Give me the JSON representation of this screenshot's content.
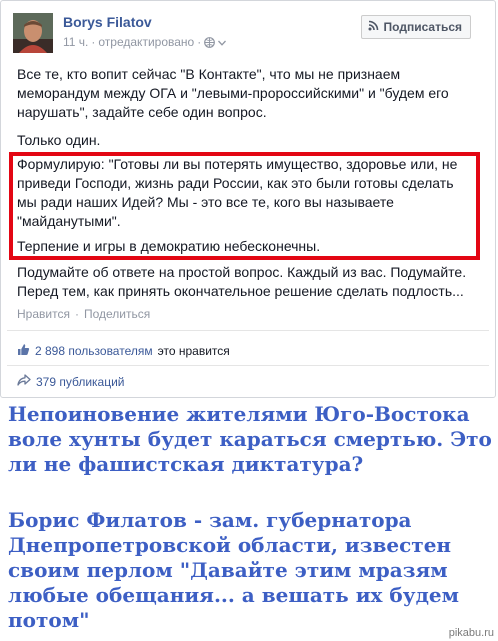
{
  "post": {
    "author": "Borys Filatov",
    "time": "11 ч.",
    "separator": "·",
    "edited": "отредактировано",
    "subscribe_label": "Подписаться",
    "paragraphs": [
      "Все те, кто вопит сейчас \"В Контакте\", что мы не признаем меморандум между ОГА и \"левыми-пророссийскими\" и \"будем его нарушать\", задайте себе один вопрос.",
      "Только один.",
      "Формулирую: \"Готовы ли вы потерять имущество, здоровье или, не приведи Господи, жизнь ради России, как это были готовы сделать мы ради наших Идей? Мы - это все те, кого вы называете \"майданутыми\".",
      "Терпение и игры в демократию небесконечны.",
      "Подумайте об ответе на простой вопрос. Каждый из вас. Подумайте.",
      "Перед тем, как принять окончательное решение сделать подлость..."
    ],
    "actions": {
      "like": "Нравится",
      "dot": "·",
      "share": "Поделиться"
    },
    "likes": {
      "count": "2 898 пользователям",
      "suffix": "это нравится"
    },
    "shares": "379 публикаций"
  },
  "caption": {
    "line1": "Непоиновение жителями Юго-Востока воле хунты будет караться смертью. Это ли не фашистская диктатура?",
    "line2": "Борис Филатов - зам. губернатора Днепропетровской области, известен своим перлом \"Давайте этим мразям любые обещания... а вешать их будем потом\""
  },
  "watermark": "pikabu.ru",
  "colors": {
    "link": "#3b5998",
    "muted": "#9197a3",
    "highlight_border": "#e30613",
    "caption": "#3d5fc4"
  },
  "icons": {
    "globe": "globe-icon",
    "chevron": "chevron-down-icon",
    "rss": "rss-icon",
    "thumb": "thumbs-up-icon",
    "share": "share-arrow-icon"
  }
}
